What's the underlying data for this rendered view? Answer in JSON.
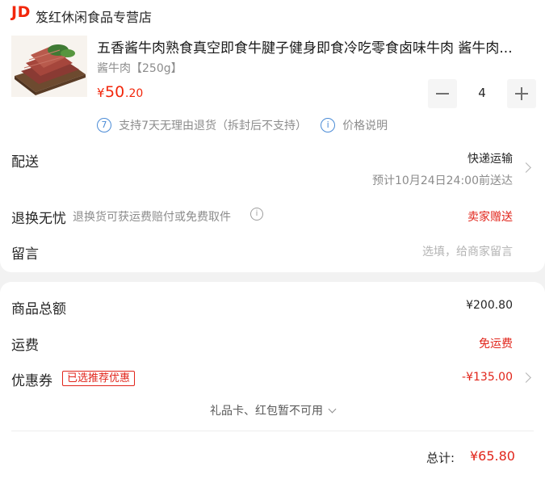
{
  "shop": {
    "logo_text": "JD",
    "name": "笈红休闲食品专营店"
  },
  "product": {
    "thumbnail_icon": "beef-slices-image",
    "title": "五香酱牛肉熟食真空即食牛腱子健身即食冷吃零食卤味牛肉 酱牛肉...",
    "spec": "酱牛肉【250g】",
    "price_currency": "¥",
    "price_int": "50",
    "price_dec": ".20",
    "quantity": "4"
  },
  "services": {
    "return_days_icon_text": "7",
    "return_policy": "支持7天无理由退货（拆封后不支持）",
    "price_info_icon_text": "i",
    "price_info": "价格说明"
  },
  "delivery": {
    "label": "配送",
    "method": "快递运输",
    "eta": "预计10月24日24:00前送达"
  },
  "returns": {
    "label": "退换无忧",
    "sub": "退换货可获运费赔付或免费取件",
    "info_icon_text": "i",
    "value": "卖家赠送"
  },
  "message": {
    "label": "留言",
    "placeholder": "选填，给商家留言"
  },
  "summary": {
    "goods_total_label": "商品总额",
    "goods_total_value": "¥200.80",
    "shipping_label": "运费",
    "shipping_value": "免运费",
    "coupon_label": "优惠券",
    "coupon_badge": "已选推荐优惠",
    "coupon_value": "-¥135.00",
    "gift_card_note": "礼品卡、红包暂不可用",
    "grand_total_label": "总计:",
    "grand_total_value": "¥65.80"
  },
  "colors": {
    "accent_red": "#e1251b",
    "link_blue": "#4a8bd6",
    "background": "#f2f2f2"
  }
}
